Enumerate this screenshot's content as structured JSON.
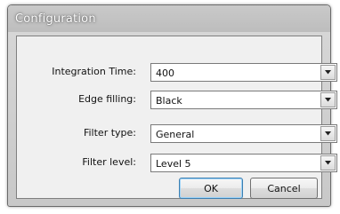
{
  "window": {
    "title": "Configuration"
  },
  "fields": [
    {
      "label": "Integration Time:",
      "value": "400"
    },
    {
      "label": "Edge filling:",
      "value": "Black"
    },
    {
      "label": "Filter type:",
      "value": "General"
    },
    {
      "label": "Filter level:",
      "value": "Level 5"
    }
  ],
  "buttons": {
    "ok_label": "OK",
    "cancel_label": "Cancel"
  },
  "icons": {
    "dropdown": "chevron-down-icon"
  }
}
